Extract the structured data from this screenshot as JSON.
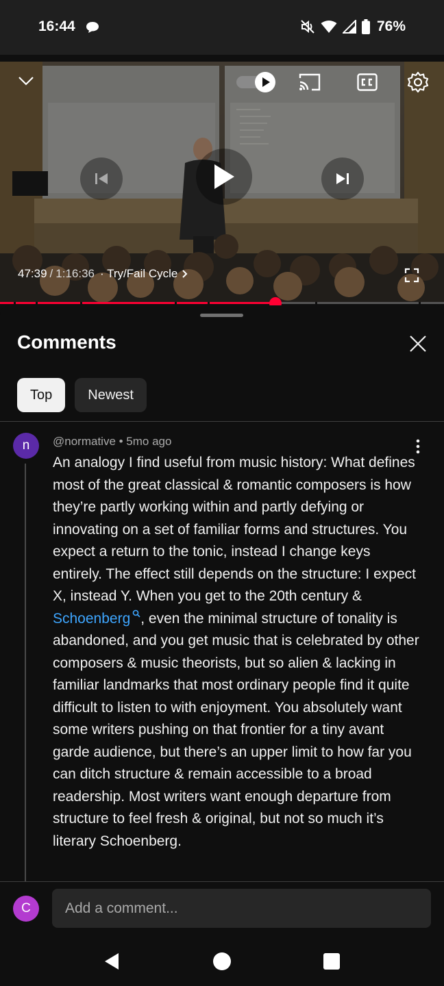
{
  "status_bar": {
    "time": "16:44",
    "battery": "76%",
    "icons": [
      "chat-icon",
      "mute-icon",
      "wifi-icon",
      "signal-icon",
      "battery-icon"
    ]
  },
  "player": {
    "autoplay_on": true,
    "current_time": "47:39",
    "separator": " / ",
    "duration": "1:16:36",
    "chapter": "· Try/Fail Cycle",
    "progress_fraction": 0.621,
    "icons": [
      "collapse-chevron-icon",
      "autoplay-toggle-icon",
      "cast-icon",
      "captions-icon",
      "settings-icon",
      "previous-icon",
      "play-icon",
      "next-icon",
      "fullscreen-icon",
      "chapter-chevron-icon"
    ],
    "colors": {
      "progress": "#ff0033"
    }
  },
  "comments": {
    "title": "Comments",
    "chips": [
      {
        "label": "Top",
        "active": true
      },
      {
        "label": "Newest",
        "active": false
      }
    ],
    "items": [
      {
        "avatar_letter": "n",
        "avatar_color": "#5b2aa8",
        "author": "@normative",
        "age": "5mo ago",
        "meta": "@normative • 5mo ago",
        "text_before": "An analogy I find useful from music history: What defines most of the great classical & romantic composers is how they’re partly working within and partly defying or innovating on a set of familiar forms and structures. You expect a return to the tonic, instead I change keys entirely. The effect still depends on the structure: I expect X, instead Y. When you get to the 20th century & ",
        "link": "Schoenberg",
        "link_icon": "search-icon",
        "text_after": ", even the minimal structure of tonality is abandoned, and you get music that is celebrated by other composers & music theorists, but so alien & lacking in familiar landmarks that most ordinary people find it quite difficult to listen to with enjoyment. You absolutely want some writers pushing on that frontier for a tiny avant garde audience, but there’s an upper limit to how far you can ditch structure & remain accessible to a broad readership. Most writers want enough departure from structure to feel fresh & original, but not so much it’s literary Schoenberg."
      }
    ],
    "composer": {
      "avatar_letter": "C",
      "avatar_color": "#b33bd0",
      "placeholder": "Add a comment..."
    }
  },
  "nav_bar": {
    "icons": [
      "back-icon",
      "home-icon",
      "recents-icon"
    ]
  }
}
